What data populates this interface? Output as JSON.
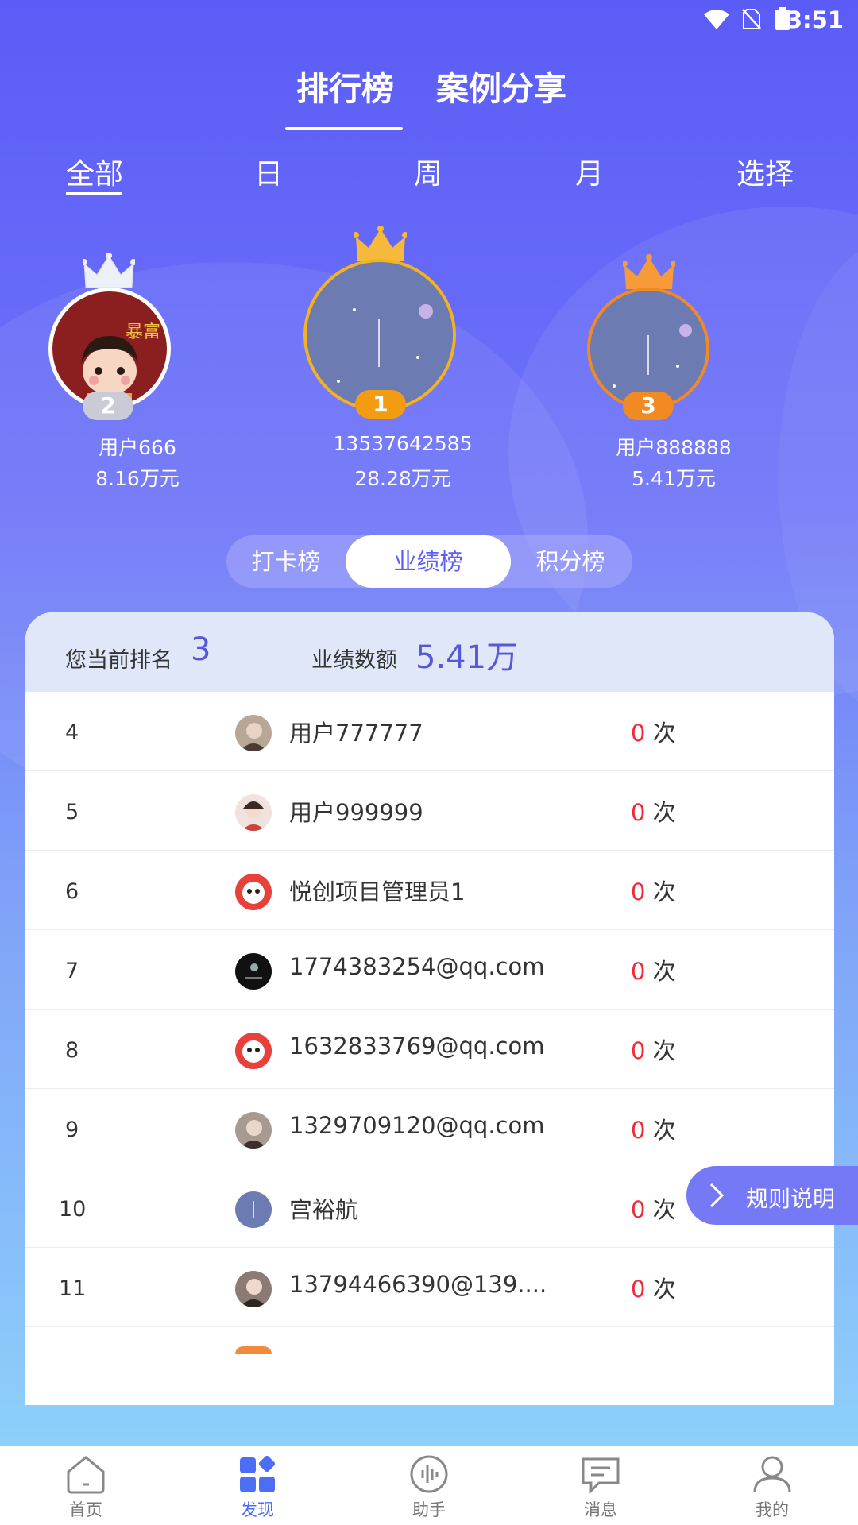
{
  "status": {
    "time": "3:51",
    "wifi_icon": "wifi-icon",
    "sim_icon": "no-sim-icon",
    "battery_icon": "battery-icon"
  },
  "top_tabs": [
    {
      "label": "排行榜",
      "active": true
    },
    {
      "label": "案例分享",
      "active": false
    }
  ],
  "periods": [
    {
      "label": "全部",
      "active": true
    },
    {
      "label": "日"
    },
    {
      "label": "周"
    },
    {
      "label": "月"
    },
    {
      "label": "选择"
    }
  ],
  "podium": {
    "first": {
      "rank": "1",
      "name": "13537642585",
      "value": "28.28万元",
      "crown_color": "#f6b93b",
      "badge_color": "#f39c12"
    },
    "second": {
      "rank": "2",
      "name": "用户666",
      "value": "8.16万元",
      "crown_color": "#eef0f8",
      "badge_color": "#c9ccd6"
    },
    "third": {
      "rank": "3",
      "name": "用户888888",
      "value": "5.41万元",
      "crown_color": "#f79a3a",
      "badge_color": "#f28a24"
    }
  },
  "segments": [
    {
      "label": "打卡榜"
    },
    {
      "label": "业绩榜",
      "active": true
    },
    {
      "label": "积分榜"
    }
  ],
  "summary": {
    "rank_label": "您当前排名",
    "rank_value": "3",
    "amount_label": "业绩数额",
    "amount_value": "5.41万"
  },
  "rows": [
    {
      "rank": "4",
      "name": "用户777777",
      "count": "0",
      "unit": "次"
    },
    {
      "rank": "5",
      "name": "用户999999",
      "count": "0",
      "unit": "次"
    },
    {
      "rank": "6",
      "name": "悦创项目管理员1",
      "count": "0",
      "unit": "次"
    },
    {
      "rank": "7",
      "name": "1774383254@qq.com",
      "count": "0",
      "unit": "次"
    },
    {
      "rank": "8",
      "name": "1632833769@qq.com",
      "count": "0",
      "unit": "次"
    },
    {
      "rank": "9",
      "name": "1329709120@qq.com",
      "count": "0",
      "unit": "次"
    },
    {
      "rank": "10",
      "name": "宫裕航",
      "count": "0",
      "unit": "次"
    },
    {
      "rank": "11",
      "name": "13794466390@139....",
      "count": "0",
      "unit": "次"
    }
  ],
  "rules_button": {
    "label": "规则说明",
    "icon": "chevron-right-icon"
  },
  "nav": [
    {
      "label": "首页",
      "icon": "home-icon"
    },
    {
      "label": "发现",
      "icon": "discover-icon",
      "active": true
    },
    {
      "label": "助手",
      "icon": "voice-icon"
    },
    {
      "label": "消息",
      "icon": "message-icon"
    },
    {
      "label": "我的",
      "icon": "user-icon"
    }
  ],
  "colors": {
    "primary": "#5b5cf7",
    "accent": "#5758d6",
    "count_red": "#ee2b37",
    "nav_active": "#4c6ef5"
  }
}
